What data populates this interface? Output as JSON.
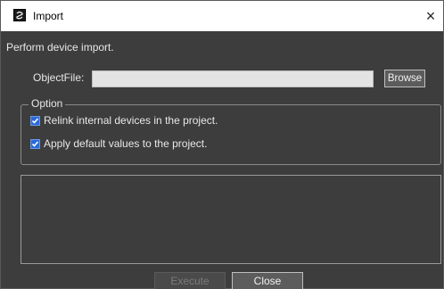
{
  "window": {
    "title": "Import",
    "close_glyph": "×"
  },
  "dialog": {
    "instruction": "Perform device import.",
    "object_file_label": "ObjectFile:",
    "object_file_value": "",
    "browse_label": "Browse",
    "option_legend": "Option",
    "options": [
      {
        "label": "Relink internal devices in the project.",
        "checked": true
      },
      {
        "label": "Apply default values to the project.",
        "checked": true
      }
    ],
    "log_text": "",
    "execute_label": "Execute",
    "execute_enabled": false,
    "close_label": "Close"
  },
  "icons": {
    "app": "app-logo-icon",
    "close": "close-icon",
    "check": "checkmark-icon"
  },
  "colors": {
    "background": "#3d3d3d",
    "checkbox": "#2b6ad6",
    "text": "#e8e8e8",
    "disabled_text": "#7b7b7b"
  }
}
